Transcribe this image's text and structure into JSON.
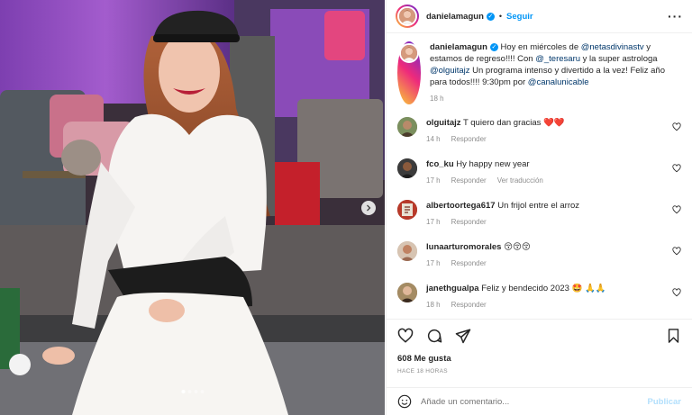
{
  "colors": {
    "accent": "#0095f6",
    "like_red": "#ed4956",
    "secondary_text": "#8e8e8e",
    "link": "#00376b"
  },
  "photo": {
    "carousel_dots": 4,
    "active_dot": 0,
    "next_icon": "chevron-right-icon"
  },
  "header": {
    "username": "danielamagun",
    "separator": "•",
    "follow_label": "Seguir",
    "more_icon": "more-horizontal-icon"
  },
  "caption": {
    "username": "danielamagun",
    "text_1": "Hoy en miércoles de ",
    "mention_1": "@netasdivinastv",
    "text_2": " y estamos de regreso!!!! Con ",
    "mention_2": "@_teresaru",
    "text_3": " y la super astrologa ",
    "mention_3": "@olguitajz",
    "text_4": " Un programa intenso y divertido a la vez! Feliz año para todos!!!! 9:30pm por ",
    "mention_4": "@canalunicable",
    "time": "18 h"
  },
  "comments": [
    {
      "username": "olguitajz",
      "text": "T quiero dan gracias ❤️❤️",
      "time": "14 h",
      "reply": "Responder",
      "extra": ""
    },
    {
      "username": "fco_ku",
      "text": "Hy happy new year",
      "time": "17 h",
      "reply": "Responder",
      "extra": "Ver traducción"
    },
    {
      "username": "albertoortega617",
      "text": "Un frijol entre el arroz",
      "time": "17 h",
      "reply": "Responder",
      "extra": ""
    },
    {
      "username": "lunaarturomorales",
      "text": "😚😚😚",
      "time": "17 h",
      "reply": "Responder",
      "extra": ""
    },
    {
      "username": "janethgualpa",
      "text": "Feliz y bendecido 2023 🤩 🙏🙏",
      "time": "18 h",
      "reply": "Responder",
      "extra": ""
    }
  ],
  "actions": {
    "like_icon": "heart-icon",
    "comment_icon": "comment-icon",
    "share_icon": "send-icon",
    "save_icon": "bookmark-icon",
    "likes": "608 Me gusta",
    "posted_ago": "HACE 18 HORAS"
  },
  "add_comment": {
    "emoji_icon": "emoji-icon",
    "placeholder": "Añade un comentario...",
    "post_label": "Publicar"
  }
}
